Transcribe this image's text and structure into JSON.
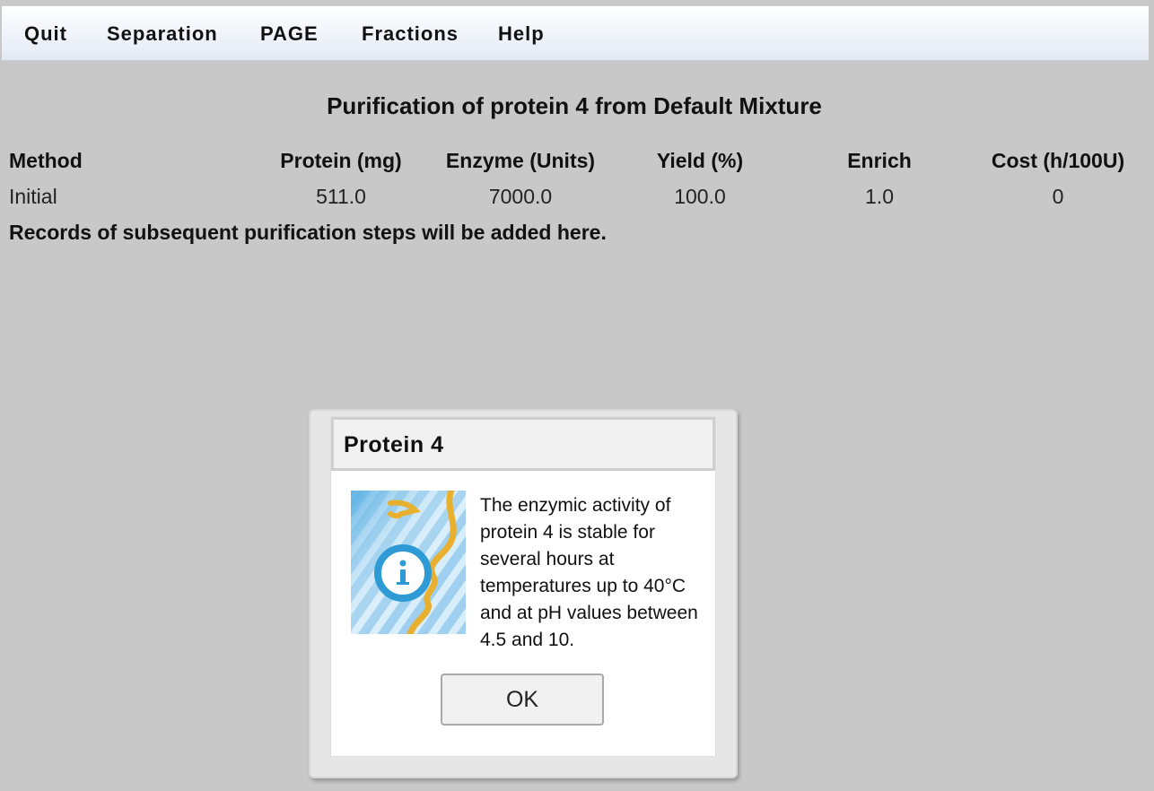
{
  "menu": {
    "items": [
      "Quit",
      "Separation",
      "PAGE",
      "Fractions",
      "Help"
    ]
  },
  "page": {
    "title": "Purification of protein 4 from Default Mixture",
    "table": {
      "headers": [
        "Method",
        "Protein (mg)",
        "Enzyme (Units)",
        "Yield (%)",
        "Enrich",
        "Cost (h/100U)"
      ],
      "rows": [
        [
          "Initial",
          "511.0",
          "7000.0",
          "100.0",
          "1.0",
          "0"
        ]
      ]
    },
    "records_note": "Records of subsequent purification steps will be added here."
  },
  "dialog": {
    "title": "Protein 4",
    "icon": "info-icon",
    "message": "The enzymic activity of protein 4 is stable for several hours at temperatures up to 40°C and at pH values between 4.5 and 10.",
    "ok_label": "OK"
  },
  "colors": {
    "background": "#c8c8c8",
    "menu_bar_bottom": "#e3e9f4",
    "dialog_frame": "#e6e6e6",
    "info_blue": "#2f9bd6",
    "info_gold": "#e9b030"
  }
}
